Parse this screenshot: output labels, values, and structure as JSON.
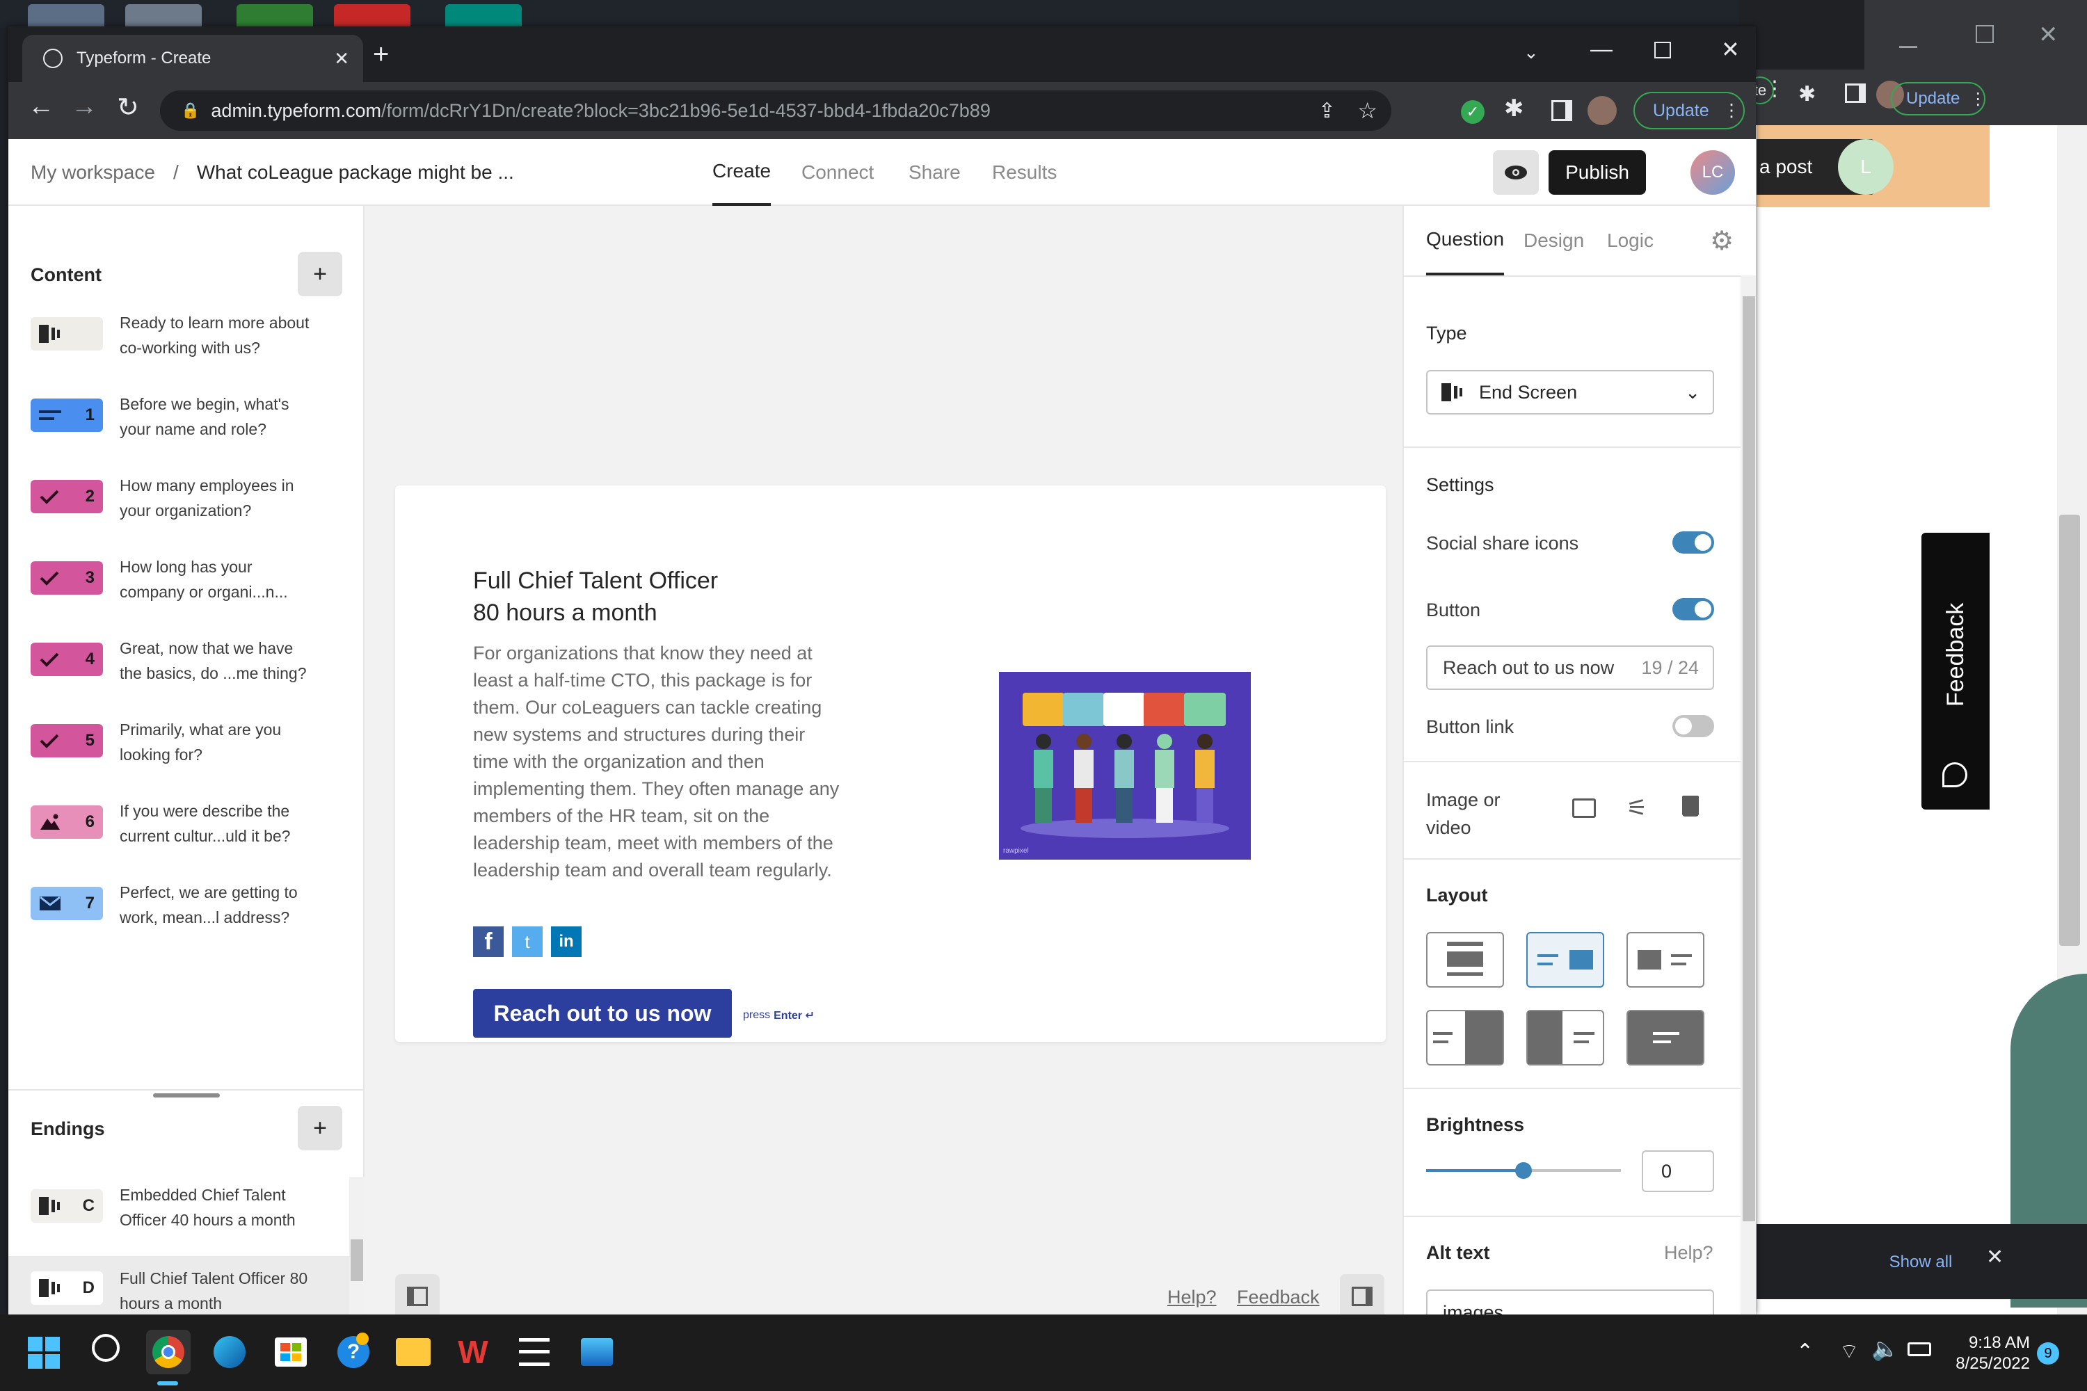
{
  "browser": {
    "tab_title": "Typeform - Create",
    "new_tab": "+",
    "url_domain": "admin.typeform.com",
    "url_path": "/form/dcRrY1Dn/create?block=3bc21b96-5e1d-4537-bbd4-1fbda20c7b89",
    "update_label": "Update"
  },
  "background_window": {
    "update_label": "Update",
    "url_fragment": "te",
    "post_label": "a post",
    "avatar_letter": "L",
    "feedback_label": "Feedback",
    "show_all": "Show all"
  },
  "header": {
    "breadcrumb_root": "My workspace",
    "breadcrumb_sep": "/",
    "form_title": "What coLeague package might be ...",
    "nav": [
      "Create",
      "Connect",
      "Share",
      "Results"
    ],
    "publish": "Publish",
    "avatar": "LC"
  },
  "content": {
    "title": "Content",
    "questions": [
      {
        "badge": "",
        "color": "#eeede8",
        "icon": "end-screen-icon",
        "line1": "Ready to learn more about",
        "line2": "co-working with us?"
      },
      {
        "badge": "1",
        "color": "#4a8ff0",
        "icon": "short-text-icon",
        "line1": "Before we begin, what's",
        "line2": "your name and role?"
      },
      {
        "badge": "2",
        "color": "#d3559c",
        "icon": "check-icon",
        "line1": "How many employees in",
        "line2": "your organization?"
      },
      {
        "badge": "3",
        "color": "#d3559c",
        "icon": "check-icon",
        "line1": "How long has your",
        "line2": "company or organi...n..."
      },
      {
        "badge": "4",
        "color": "#d3559c",
        "icon": "check-icon",
        "line1": "Great, now that we have",
        "line2": "the basics, do ...me thing?"
      },
      {
        "badge": "5",
        "color": "#d3559c",
        "icon": "check-icon",
        "line1": "Primarily, what are you",
        "line2": "looking for?"
      },
      {
        "badge": "6",
        "color": "#e88fb9",
        "icon": "picture-choice-icon",
        "line1": "If you were describe the",
        "line2": "current cultur...uld it be?"
      },
      {
        "badge": "7",
        "color": "#8ec0f5",
        "icon": "email-icon",
        "line1": "Perfect, we are getting to",
        "line2": "work, mean...l address?"
      }
    ]
  },
  "endings": {
    "title": "Endings",
    "items": [
      {
        "badge": "C",
        "line1": "Embedded Chief Talent",
        "line2": "Officer 40 hours a month"
      },
      {
        "badge": "D",
        "line1": "Full Chief Talent Officer 80",
        "line2": "hours a month"
      }
    ]
  },
  "preview": {
    "heading1": "Full Chief Talent Officer",
    "heading2": "80 hours a month",
    "paragraph": "For organizations that know they need at least a half-time CTO, this package is for them. Our coLeaguers can tackle creating new systems and structures during their time with the organization and then implementing them. They often manage any members of the HR team, sit on the leadership team, meet with members of the leadership team and overall team regularly.",
    "button": "Reach out to us now",
    "press": "press",
    "enter": "Enter ↵",
    "image_caption": "rawpixel"
  },
  "canvas_footer": {
    "help": "Help?",
    "feedback": "Feedback"
  },
  "right": {
    "tabs": [
      "Question",
      "Design",
      "Logic"
    ],
    "type_label": "Type",
    "type_value": "End Screen",
    "settings": "Settings",
    "social": "Social share icons",
    "social_on": true,
    "button_label": "Button",
    "button_on": true,
    "button_text": "Reach out to us now",
    "button_count": "19 / 24",
    "button_link": "Button link",
    "button_link_on": false,
    "image_label_1": "Image or",
    "image_label_2": "video",
    "layout": "Layout",
    "brightness": "Brightness",
    "brightness_value": "0",
    "alt_text": "Alt text",
    "alt_help": "Help?",
    "alt_value": "images",
    "accent": "#3d84b8"
  },
  "taskbar": {
    "time": "9:18 AM",
    "date": "8/25/2022",
    "notifications": "9"
  }
}
